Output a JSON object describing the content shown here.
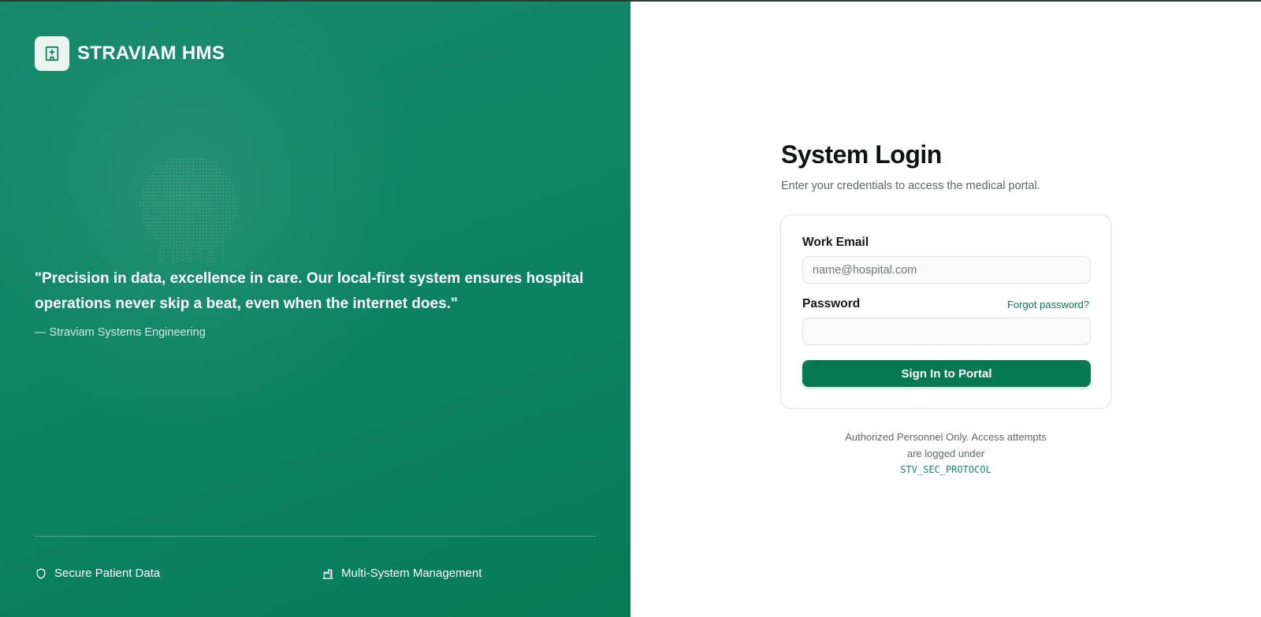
{
  "brand": {
    "name": "STRAVIAM HMS",
    "logo_icon": "hospital-icon"
  },
  "hero": {
    "quote": "\"Precision in data, excellence in care. Our local-first system ensures hospital operations never skip a beat, even when the internet does.\"",
    "author": "— Straviam Systems Engineering"
  },
  "features": [
    {
      "label": "Secure Patient Data",
      "icon": "shield-icon"
    },
    {
      "label": "Multi-System Management",
      "icon": "building-chart-icon"
    }
  ],
  "login": {
    "title": "System Login",
    "subtitle": "Enter your credentials to access the medical portal.",
    "email_label": "Work Email",
    "email_placeholder": "name@hospital.com",
    "email_value": "",
    "password_label": "Password",
    "password_value": "",
    "forgot_label": "Forgot password?",
    "submit_label": "Sign In to Portal"
  },
  "notice": {
    "text": "Authorized Personnel Only. Access attempts are logged under",
    "code": "STV_SEC_PROTOCOL"
  },
  "colors": {
    "brand_green": "#067852",
    "panel_green": "#0c8560",
    "link_green": "#0b7a55"
  }
}
